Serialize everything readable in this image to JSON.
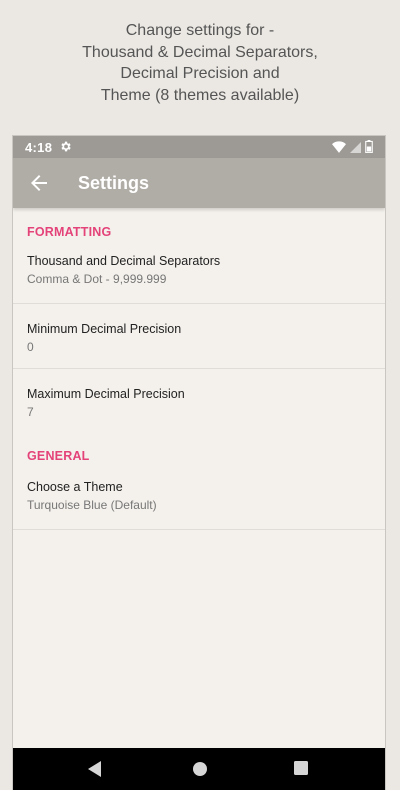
{
  "caption": {
    "lines": [
      "Change settings for -",
      "Thousand & Decimal Separators,",
      "Decimal Precision and",
      "Theme (8 themes available)"
    ]
  },
  "statusbar": {
    "time": "4:18",
    "icons": [
      "gear-icon",
      "wifi-icon",
      "signal-icon",
      "battery-icon"
    ]
  },
  "appbar": {
    "back_icon": "arrow-left-icon",
    "title": "Settings"
  },
  "settings": {
    "formatting_header": "FORMATTING",
    "separators": {
      "title": "Thousand and Decimal Separators",
      "summary": "Comma & Dot - 9,999.999"
    },
    "min_precision": {
      "title": "Minimum Decimal Precision",
      "summary": "0"
    },
    "max_precision": {
      "title": "Maximum Decimal Precision",
      "summary": "7"
    },
    "general_header": "GENERAL",
    "theme": {
      "title": "Choose a Theme",
      "summary": "Turquoise Blue (Default)"
    }
  },
  "navbar": {
    "icons": [
      "back-triangle-icon",
      "home-circle-icon",
      "recents-square-icon"
    ]
  },
  "colors": {
    "accent": "#e4437a",
    "appbar": "#b0aca6",
    "statusbar": "#9d9a95",
    "background": "#f4f1ec"
  }
}
